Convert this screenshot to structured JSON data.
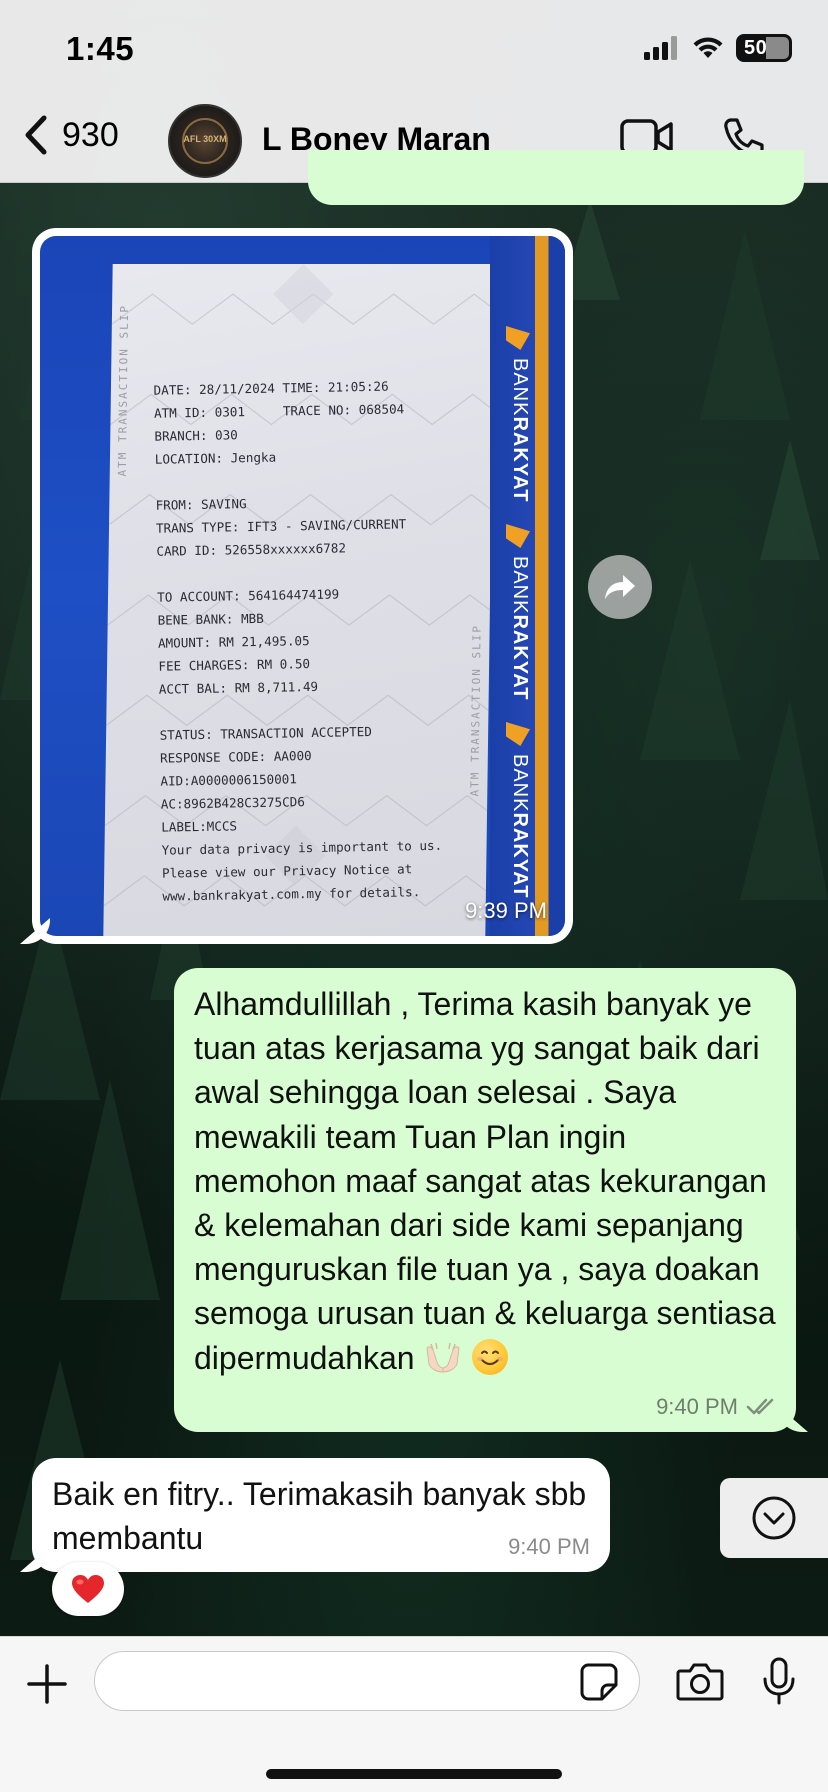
{
  "status_bar": {
    "time": "1:45",
    "battery": "50",
    "icons": [
      "cellular-signal-icon",
      "wifi-icon",
      "battery-icon"
    ]
  },
  "header": {
    "back_count": "930",
    "contact_name": "L Boney Maran",
    "avatar_text": "AFL 30XM",
    "icons": [
      "chevron-left-icon",
      "video-camera-icon",
      "phone-icon"
    ]
  },
  "messages": {
    "image": {
      "time": "9:39 PM",
      "receipt": {
        "lines": [
          "DATE: 28/11/2024 TIME: 21:05:26",
          "ATM ID: 0301     TRACE NO: 068504",
          "BRANCH: 030",
          "LOCATION: Jengka",
          "",
          "FROM: SAVING",
          "TRANS TYPE: IFT3 - SAVING/CURRENT",
          "CARD ID: 526558xxxxxx6782",
          "",
          "TO ACCOUNT: 564164474199",
          "BENE BANK: MBB",
          "AMOUNT: RM 21,495.05",
          "FEE CHARGES: RM 0.50",
          "ACCT BAL: RM 8,711.49",
          "",
          "STATUS: TRANSACTION ACCEPTED",
          "RESPONSE CODE: AA000",
          "AID:A0000006150001",
          "AC:8962B428C3275CD6",
          "LABEL:MCCS",
          "Your data privacy is important to us.",
          "Please view our Privacy Notice at",
          "www.bankrakyat.com.my for details."
        ],
        "brand_prefix": "BANK",
        "brand_name": "RAKYAT",
        "side_label": "ATM TRANSACTION SLIP"
      }
    },
    "outgoing": {
      "text": "Alhamdullillah , Terima kasih banyak ye tuan atas kerjasama yg sangat baik dari awal sehingga loan selesai . Saya mewakili team Tuan Plan ingin memohon maaf sangat atas kekurangan & kelemahan dari side kami sepanjang menguruskan file tuan ya , saya doakan semoga urusan tuan & keluarga sentiasa dipermudahkan",
      "emojis": [
        "palms-up-together-emoji",
        "smiling-face-emoji"
      ],
      "time": "9:40 PM",
      "status": "read"
    },
    "incoming": {
      "text": "Baik en fitry.. Terimakasih banyak sbb membantu",
      "time": "9:40 PM",
      "reaction": "red-heart-emoji"
    }
  },
  "composer": {
    "value": "",
    "icons": [
      "plus-icon",
      "sticker-icon",
      "camera-icon",
      "microphone-icon"
    ]
  },
  "colors": {
    "outgoing_bubble": "#d8fdd2",
    "incoming_bubble": "#ffffff",
    "header_bg": "#eeeef0",
    "receipt_blue": "#1e4fc4",
    "brand_orange": "#e39a24"
  }
}
